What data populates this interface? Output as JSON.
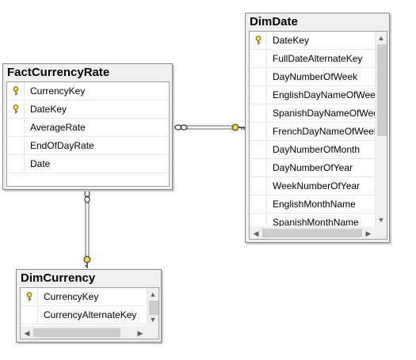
{
  "tables": {
    "fact_currency_rate": {
      "title": "FactCurrencyRate",
      "columns": [
        {
          "name": "CurrencyKey",
          "key": true
        },
        {
          "name": "DateKey",
          "key": true
        },
        {
          "name": "AverageRate",
          "key": false
        },
        {
          "name": "EndOfDayRate",
          "key": false
        },
        {
          "name": "Date",
          "key": false
        }
      ]
    },
    "dim_date": {
      "title": "DimDate",
      "columns": [
        {
          "name": "DateKey",
          "key": true
        },
        {
          "name": "FullDateAlternateKey",
          "key": false
        },
        {
          "name": "DayNumberOfWeek",
          "key": false
        },
        {
          "name": "EnglishDayNameOfWeek",
          "key": false
        },
        {
          "name": "SpanishDayNameOfWeek",
          "key": false
        },
        {
          "name": "FrenchDayNameOfWeek",
          "key": false
        },
        {
          "name": "DayNumberOfMonth",
          "key": false
        },
        {
          "name": "DayNumberOfYear",
          "key": false
        },
        {
          "name": "WeekNumberOfYear",
          "key": false
        },
        {
          "name": "EnglishMonthName",
          "key": false
        },
        {
          "name": "SpanishMonthName",
          "key": false
        }
      ]
    },
    "dim_currency": {
      "title": "DimCurrency",
      "columns": [
        {
          "name": "CurrencyKey",
          "key": true
        },
        {
          "name": "CurrencyAlternateKey",
          "key": false
        }
      ]
    }
  },
  "icons": {
    "primary_key": "key-icon",
    "relationship_many": "infinity-icon",
    "relationship_one": "key-icon"
  },
  "colors": {
    "key_gold": "#e8c020",
    "table_border": "#828790",
    "line": "#808080"
  }
}
